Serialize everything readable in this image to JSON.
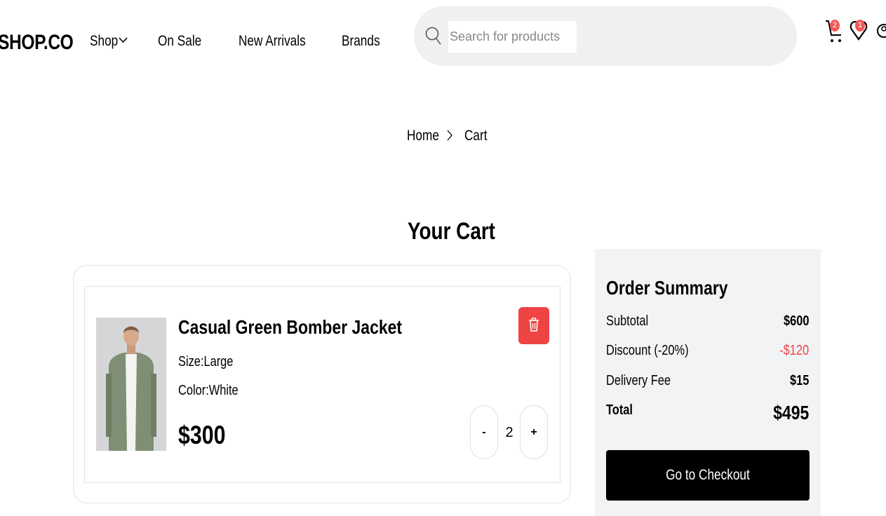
{
  "header": {
    "logo": "SHOP.CO",
    "nav": {
      "shop": "Shop",
      "on_sale": "On Sale",
      "new_arrivals": "New Arrivals",
      "brands": "Brands"
    },
    "search": {
      "placeholder": "Search for products",
      "value": ""
    },
    "cart_badge": "2",
    "wishlist_badge": "1",
    "icons": [
      "search-icon",
      "cart-icon",
      "heart-icon",
      "user-icon"
    ],
    "badge_color": "#f05a58"
  },
  "breadcrumb": {
    "home": "Home",
    "current": "Cart"
  },
  "page_title": "Your Cart",
  "cart": {
    "items": [
      {
        "name": "Casual Green Bomber Jacket",
        "size": "Size:Large",
        "color": "Color:White",
        "price": "$300",
        "quantity": "2",
        "minus_label": "-",
        "plus_label": "+",
        "delete_icon": "trash-icon",
        "delete_color": "#ef4444"
      }
    ]
  },
  "summary": {
    "title": "Order Summary",
    "subtotal_label": "Subtotal",
    "subtotal_value": "$600",
    "discount_label": "Discount (-20%)",
    "discount_value": "-$120",
    "delivery_label": "Delivery Fee",
    "delivery_value": "$15",
    "total_label": "Total",
    "total_value": "$495",
    "checkout_label": "Go to Checkout",
    "panel_color": "#f2f3f5",
    "discount_color": "#ef4444"
  }
}
